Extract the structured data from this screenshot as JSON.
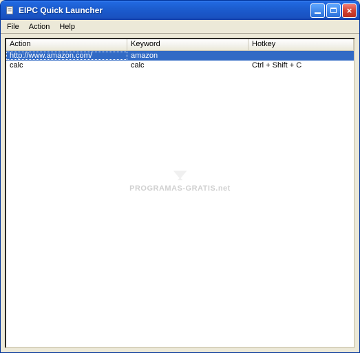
{
  "window": {
    "title": "EIPC Quick Launcher"
  },
  "menubar": {
    "items": [
      {
        "label": "File"
      },
      {
        "label": "Action"
      },
      {
        "label": "Help"
      }
    ]
  },
  "listview": {
    "columns": [
      {
        "label": "Action"
      },
      {
        "label": "Keyword"
      },
      {
        "label": "Hotkey"
      }
    ],
    "rows": [
      {
        "action": "http://www.amazon.com/",
        "keyword": "amazon",
        "hotkey": "",
        "selected": true
      },
      {
        "action": "calc",
        "keyword": "calc",
        "hotkey": "Ctrl + Shift + C",
        "selected": false
      }
    ]
  },
  "watermark": {
    "text": "PROGRAMAS-GRATIS.net"
  }
}
